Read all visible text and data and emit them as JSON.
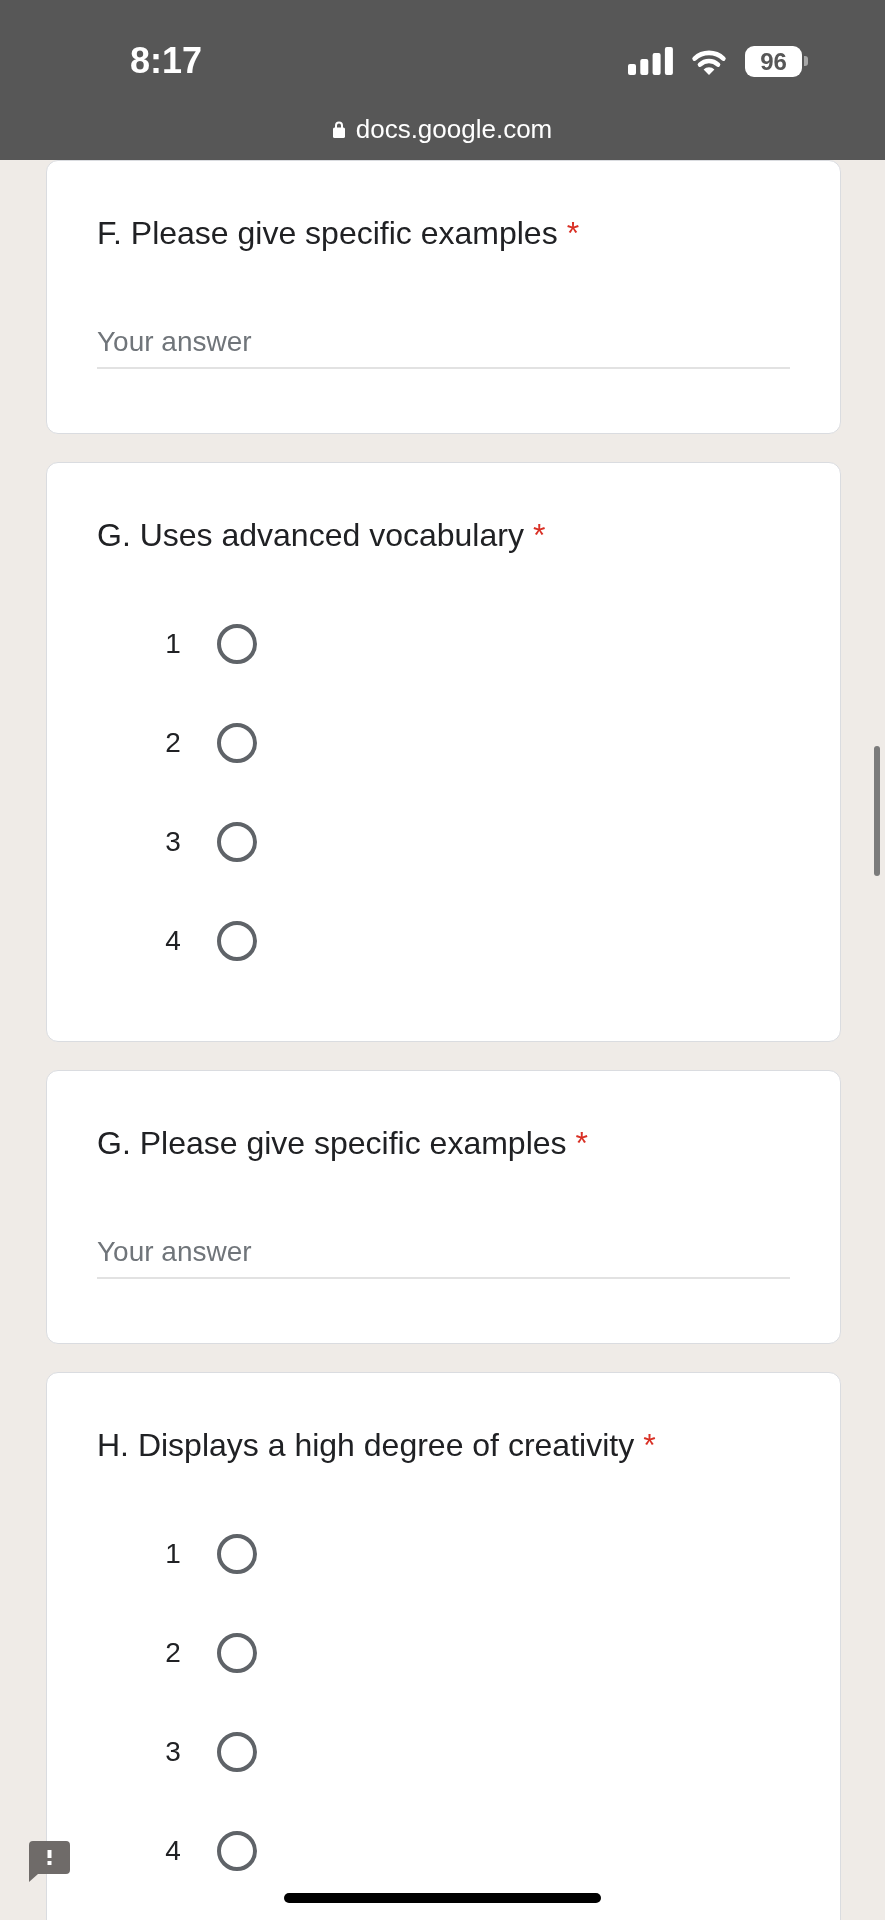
{
  "status_bar": {
    "time": "8:17",
    "battery": "96"
  },
  "address_bar": {
    "url": "docs.google.com"
  },
  "questions": [
    {
      "kind": "text",
      "title": "F. Please give specific examples",
      "required_mark": "*",
      "answer": {
        "placeholder": "Your answer"
      }
    },
    {
      "kind": "scale",
      "title": "G. Uses advanced vocabulary",
      "required_mark": "*",
      "options": [
        {
          "label": "1",
          "selected": false
        },
        {
          "label": "2",
          "selected": false
        },
        {
          "label": "3",
          "selected": false
        },
        {
          "label": "4",
          "selected": false
        }
      ]
    },
    {
      "kind": "text",
      "title": "G. Please give specific examples",
      "required_mark": "*",
      "answer": {
        "placeholder": "Your answer"
      }
    },
    {
      "kind": "scale",
      "title": "H. Displays a high degree of creativity",
      "required_mark": "*",
      "options": [
        {
          "label": "1",
          "selected": false
        },
        {
          "label": "2",
          "selected": false
        },
        {
          "label": "3",
          "selected": false
        },
        {
          "label": "4",
          "selected": false
        }
      ]
    }
  ]
}
